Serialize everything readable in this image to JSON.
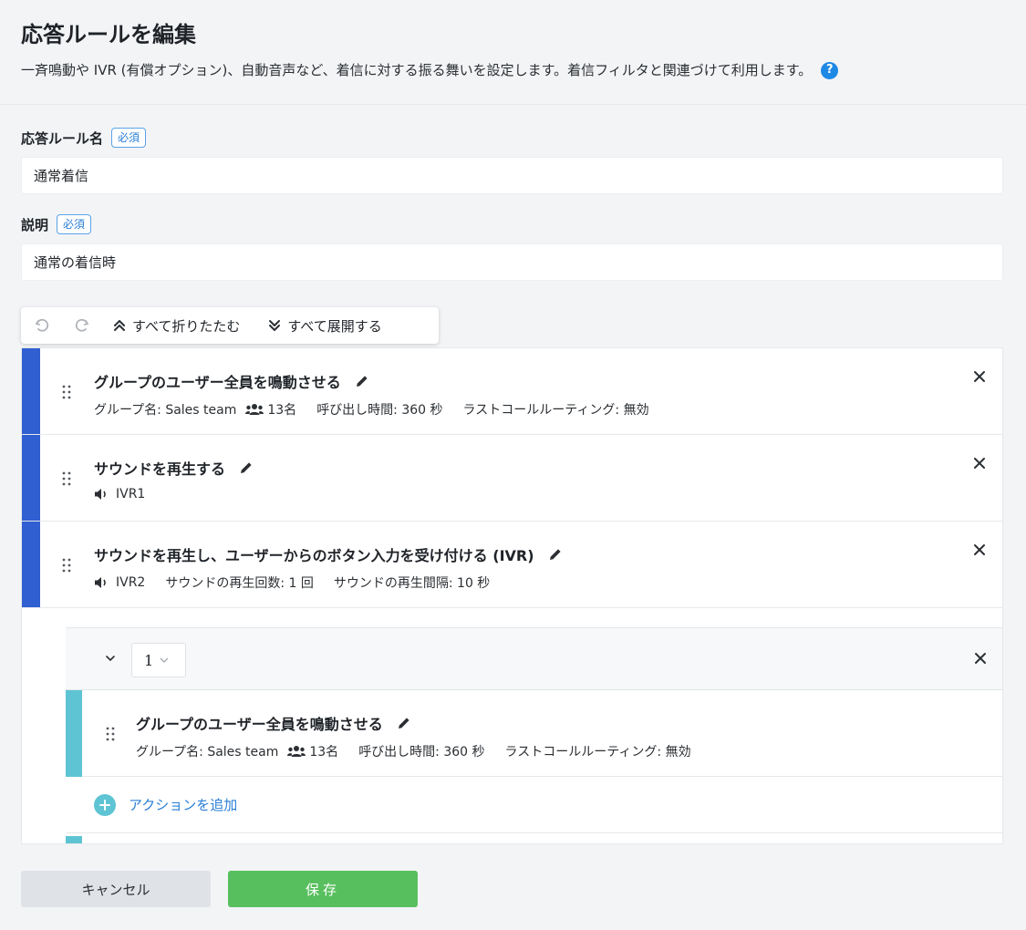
{
  "header": {
    "title": "応答ルールを編集",
    "description": "一斉鳴動や IVR (有償オプション)、自動音声など、着信に対する振る舞いを設定します。着信フィルタと関連づけて利用します。",
    "help_glyph": "?"
  },
  "form": {
    "rule_name": {
      "label": "応答ルール名",
      "badge": "必須",
      "value": "通常着信"
    },
    "description": {
      "label": "説明",
      "badge": "必須",
      "value": "通常の着信時"
    }
  },
  "toolbar": {
    "collapse_all": "すべて折りたたむ",
    "expand_all": "すべて展開する"
  },
  "actions": [
    {
      "title": "グループのユーザー全員を鳴動させる",
      "group": "グループ名: Sales team",
      "members": "13名",
      "ring_time": "呼び出し時間: 360 秒",
      "last_call": "ラストコールルーティング: 無効"
    },
    {
      "title": "サウンドを再生する",
      "sound": "IVR1"
    },
    {
      "title": "サウンドを再生し、ユーザーからのボタン入力を受け付ける (IVR)",
      "sound": "IVR2",
      "play_count": "サウンドの再生回数: 1 回",
      "play_interval": "サウンドの再生間隔: 10 秒"
    }
  ],
  "branch": {
    "key": "1",
    "action": {
      "title": "グループのユーザー全員を鳴動させる",
      "group": "グループ名: Sales team",
      "members": "13名",
      "ring_time": "呼び出し時間: 360 秒",
      "last_call": "ラストコールルーティング: 無効"
    },
    "add_action": "アクションを追加"
  },
  "footer": {
    "cancel": "キャンセル",
    "save": "保存"
  },
  "colors": {
    "action_stripe": "#2f5fd0",
    "branch_stripe": "#5ec4d4",
    "save": "#58bf5e",
    "link": "#2a7fd6"
  }
}
